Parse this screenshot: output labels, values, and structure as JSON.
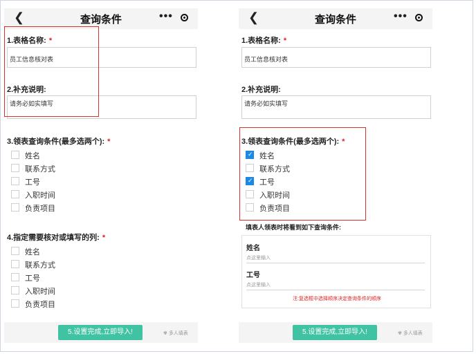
{
  "navbar": {
    "title": "查询条件",
    "back_icon": "chevron-left-icon",
    "more_icon": "more-dots-icon",
    "capture_icon": "target-icon"
  },
  "sections": {
    "table_name": {
      "label": "1.表格名称:",
      "required_mark": "*",
      "value": "员工信息核对表"
    },
    "note": {
      "label": "2.补充说明:",
      "value": "请务必如实填写"
    },
    "query_conditions": {
      "label": "3.领表查询条件(最多选两个):",
      "required_mark": "*"
    },
    "check_columns": {
      "label": "4.指定需要核对或填写的列:",
      "required_mark": "*"
    }
  },
  "options": [
    "姓名",
    "联系方式",
    "工号",
    "入职时间",
    "负责项目"
  ],
  "right_selected": [
    true,
    false,
    true,
    false,
    false
  ],
  "preview": {
    "heading": "填表人领表时将看到如下查询条件:",
    "fields": [
      {
        "label": "姓名",
        "placeholder": "点这里输入"
      },
      {
        "label": "工号",
        "placeholder": "点这里输入"
      }
    ],
    "note": "注:复选框中选择顺序决定查询条件的顺序"
  },
  "footer": {
    "submit_label": "5.设置完成,立即导入!",
    "brand": "多人填表"
  },
  "colors": {
    "accent": "#3fc3a3",
    "highlight": "#d9302c",
    "checkbox": "#1e88e5",
    "required": "#e02020"
  }
}
